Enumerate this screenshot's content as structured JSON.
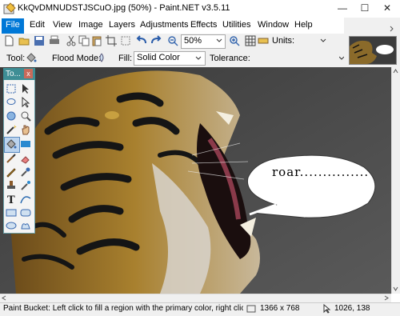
{
  "window": {
    "title": "KkQvDMNUDSTJSCuO.jpg (50%) - Paint.NET v3.5.11",
    "minimize": "—",
    "maximize": "☐",
    "close": "✕"
  },
  "menu": [
    "File",
    "Edit",
    "View",
    "Image",
    "Layers",
    "Adjustments",
    "Effects",
    "Utilities",
    "Window",
    "Help"
  ],
  "toolbar": {
    "zoom_value": "50%",
    "units_label": "Units:"
  },
  "options_bar": {
    "tool_label": "Tool:",
    "flood_mode_label": "Flood Mode:",
    "fill_label": "Fill:",
    "fill_value": "Solid Color",
    "tolerance_label": "Tolerance:"
  },
  "tools_window": {
    "title": "To...",
    "close": "x"
  },
  "canvas": {
    "bubble_text": "roar..............."
  },
  "status": {
    "hint": "Paint Bucket: Left click to fill a region with the primary color, right click to f",
    "image_size": "1366 x 768",
    "cursor_pos": "1026, 138"
  },
  "colors": {
    "accent": "#0078d7",
    "tools_title": "#3e8e95",
    "canvas_bg": "#4a4a4a"
  }
}
